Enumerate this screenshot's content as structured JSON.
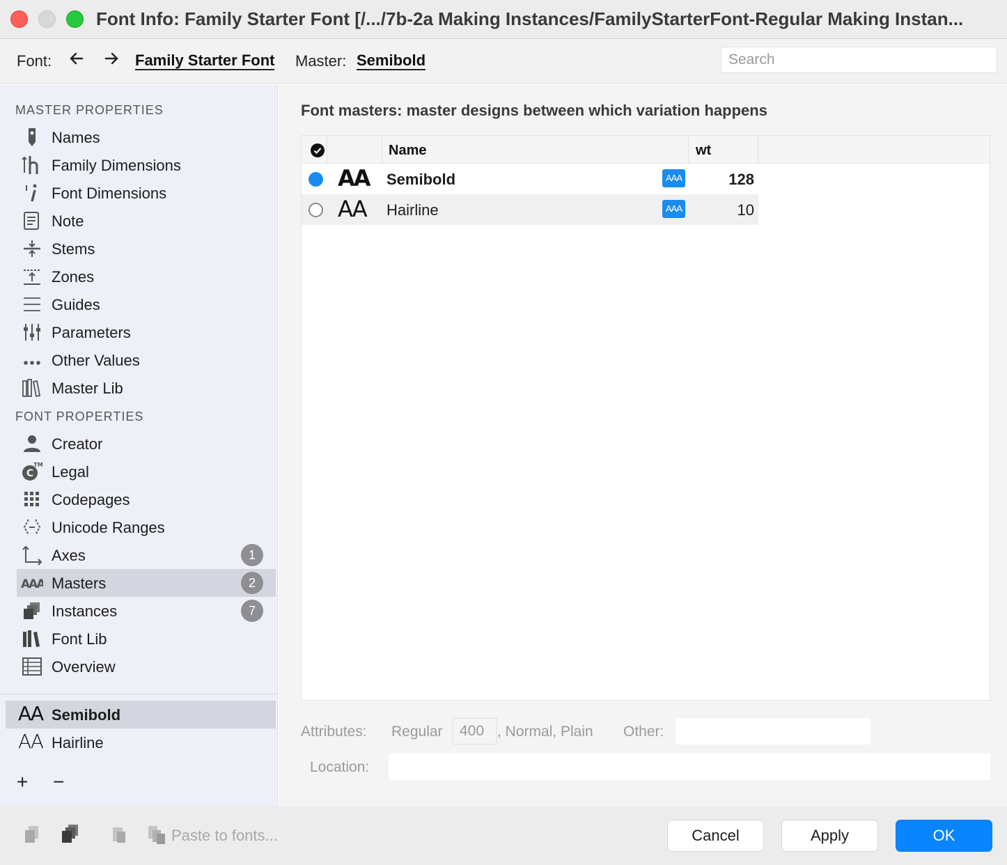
{
  "window": {
    "title": "Font Info: Family Starter Font [/.../7b-2a Making Instances/FamilyStarterFont-Regular Making Instan..."
  },
  "toolbar": {
    "font_label": "Font:",
    "font_name": "Family Starter Font",
    "master_label": "Master:",
    "master_name": "Semibold",
    "back_icon": "arrow-left-icon",
    "forward_icon": "arrow-right-icon",
    "search_placeholder": "Search"
  },
  "sidebar": {
    "master_properties_heading": "MASTER PROPERTIES",
    "master_properties": [
      {
        "label": "Names",
        "icon": "tag-icon"
      },
      {
        "label": "Family Dimensions",
        "icon": "family-dimensions-icon"
      },
      {
        "label": "Font Dimensions",
        "icon": "font-dimensions-icon"
      },
      {
        "label": "Note",
        "icon": "note-icon"
      },
      {
        "label": "Stems",
        "icon": "stems-icon"
      },
      {
        "label": "Zones",
        "icon": "zones-icon"
      },
      {
        "label": "Guides",
        "icon": "guides-icon"
      },
      {
        "label": "Parameters",
        "icon": "sliders-icon"
      },
      {
        "label": "Other Values",
        "icon": "ellipsis-icon"
      },
      {
        "label": "Master Lib",
        "icon": "library-icon"
      }
    ],
    "font_properties_heading": "FONT PROPERTIES",
    "font_properties": [
      {
        "label": "Creator",
        "icon": "person-icon"
      },
      {
        "label": "Legal",
        "icon": "copyright-icon"
      },
      {
        "label": "Codepages",
        "icon": "grid-icon"
      },
      {
        "label": "Unicode Ranges",
        "icon": "unicode-ranges-icon"
      },
      {
        "label": "Axes",
        "icon": "axes-icon",
        "badge": "1"
      },
      {
        "label": "Masters",
        "icon": "masters-icon",
        "badge": "2",
        "selected": true
      },
      {
        "label": "Instances",
        "icon": "instances-icon",
        "badge": "7"
      },
      {
        "label": "Font Lib",
        "icon": "font-library-icon"
      },
      {
        "label": "Overview",
        "icon": "table-icon"
      }
    ],
    "masters": [
      {
        "glyph": "AA",
        "name": "Semibold",
        "selected": true
      },
      {
        "glyph": "AA",
        "name": "Hairline",
        "selected": false
      }
    ],
    "add_label": "+",
    "remove_label": "−"
  },
  "main": {
    "title": "Font masters: master designs between which variation happens",
    "table": {
      "columns": [
        "Name",
        "wt"
      ],
      "rows": [
        {
          "glyph": "AA",
          "name": "Semibold",
          "wt": "128",
          "active": true,
          "badge": "AAA"
        },
        {
          "glyph": "AA",
          "name": "Hairline",
          "wt": "10",
          "active": false,
          "badge": "AAA"
        }
      ]
    },
    "attributes": {
      "label": "Attributes:",
      "weight_name": "Regular",
      "weight_value": "400",
      "rest": ", Normal, Plain",
      "other_label": "Other:",
      "location_label": "Location:"
    }
  },
  "footer": {
    "paste_label": "Paste to fonts...",
    "cancel_label": "Cancel",
    "apply_label": "Apply",
    "ok_label": "OK"
  },
  "colors": {
    "accent": "#0a84ff",
    "sidebar_bg": "#eef0f7",
    "selection": "#d3d6de",
    "badge": "#8e8e93"
  }
}
